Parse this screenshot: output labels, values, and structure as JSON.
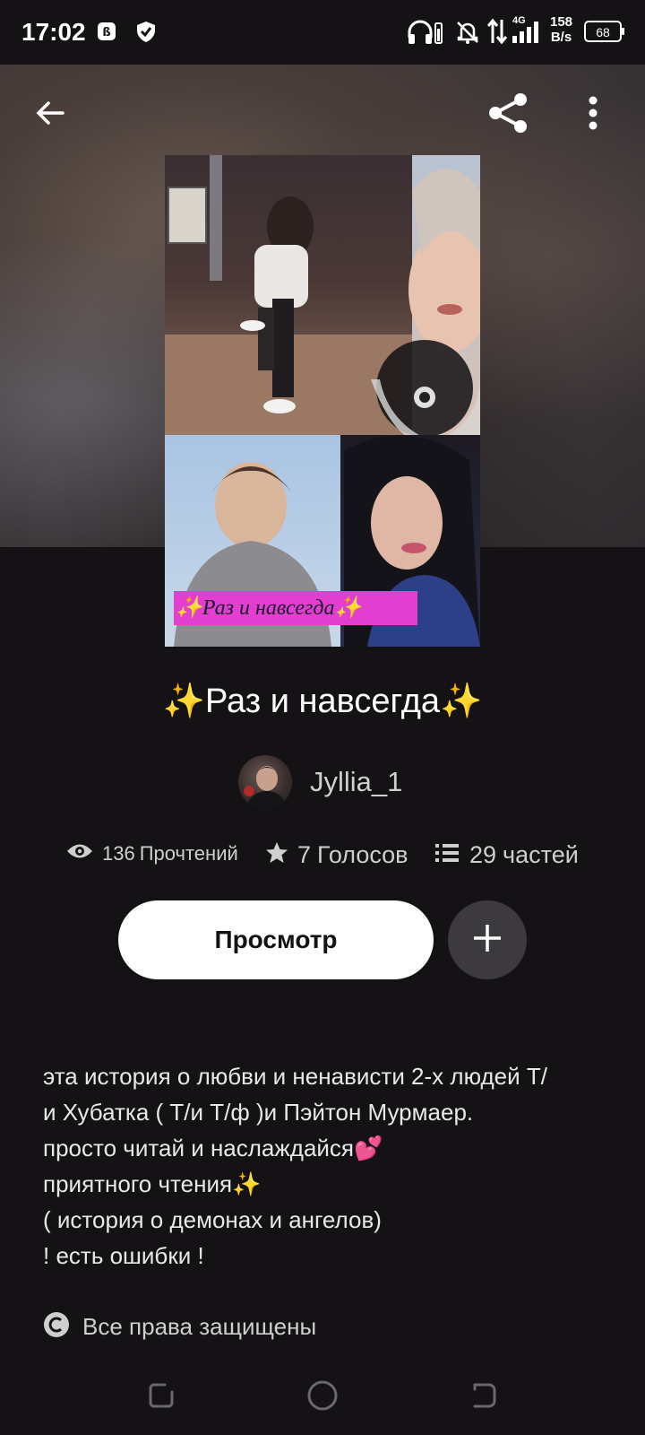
{
  "status_bar": {
    "time": "17:02",
    "network_speed_value": "158",
    "network_speed_unit": "B/s",
    "network_type": "4G",
    "battery": "68"
  },
  "toolbar": {
    "back_icon": "arrow-left-icon",
    "share_icon": "share-icon",
    "more_icon": "more-vertical-icon"
  },
  "cover": {
    "banner_text": "✨Раз и навсегда✨"
  },
  "story": {
    "title": "✨Раз и навсегда✨",
    "author": "Jyllia_1",
    "reads_count": "136",
    "reads_label": "Прочтений",
    "votes_count": "7",
    "votes_label": "Голосов",
    "parts_count": "29",
    "parts_label": "частей"
  },
  "actions": {
    "view_label": "Просмотр",
    "add_icon": "plus-icon"
  },
  "description": {
    "lines": [
      "эта история о любви и ненависти 2-х людей Т/",
      "и Хубатка ( Т/и Т/ф )и Пэйтон Мурмаер.",
      "просто читай и наслаждайся💕",
      "приятного чтения✨",
      "( история о демонах и ангелов)",
      "! есть ошибки !"
    ]
  },
  "rights": {
    "label": "Все права защищены"
  },
  "colors": {
    "background": "#141215",
    "primary_button": "#ffffff",
    "secondary_button": "#3c3a3e",
    "secondary_text": "#cfcfcf"
  }
}
